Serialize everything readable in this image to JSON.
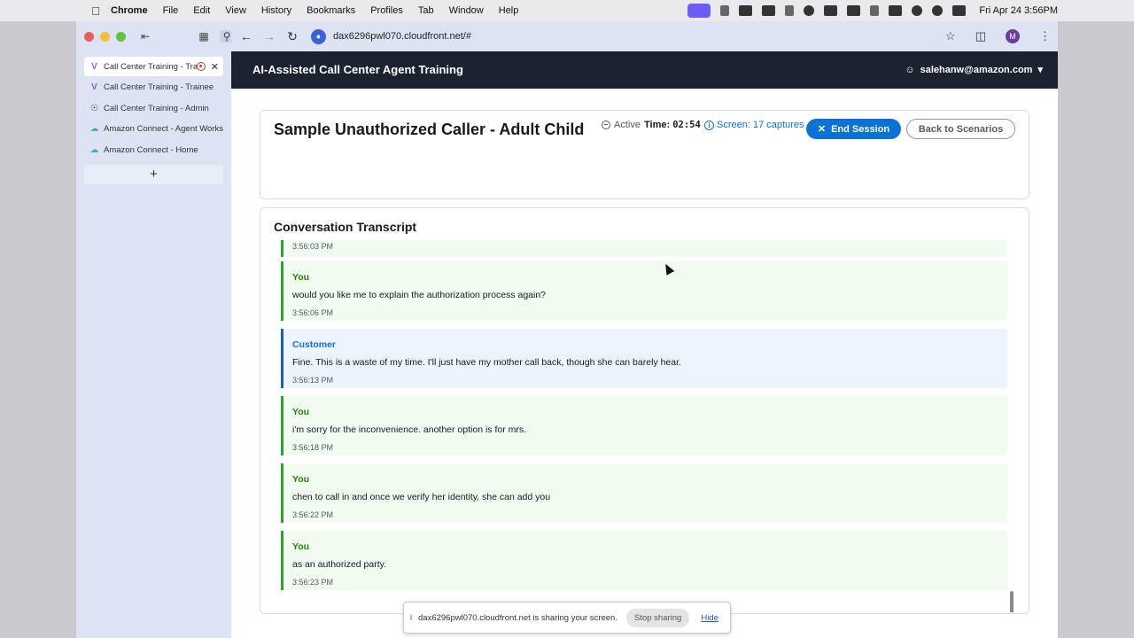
{
  "menubar": {
    "app": "Chrome",
    "items": [
      "File",
      "Edit",
      "View",
      "History",
      "Bookmarks",
      "Profiles",
      "Tab",
      "Window",
      "Help"
    ],
    "clock": "Fri Apr 24  3:56PM"
  },
  "tabs": [
    {
      "label": "Call Center Training - Trainee",
      "favicon": "v-logo-icon"
    },
    {
      "label": "Call Center Training - Trainee",
      "favicon": "v-logo-icon"
    },
    {
      "label": "Call Center Training - Admin",
      "favicon": "globe-icon"
    },
    {
      "label": "Amazon Connect - Agent Workspace",
      "favicon": "cloud-icon"
    },
    {
      "label": "Amazon Connect - Home",
      "favicon": "cloud-icon"
    }
  ],
  "newtab": "+",
  "url": "dax6296pwl070.cloudfront.net/#",
  "profile_initial": "M",
  "appbar": {
    "title": "AI-Assisted Call Center Agent Training",
    "user": "salehanw@amazon.com"
  },
  "session": {
    "title": "Sample Unauthorized Caller - Adult Child",
    "status": "Active",
    "time_label": "Time:",
    "time_value": "02:54",
    "screen": "Screen: 17 captures",
    "end_label": "End Session",
    "back_label": "Back to Scenarios"
  },
  "transcript": {
    "heading": "Conversation Transcript",
    "partial_time": "3:56:03 PM",
    "messages": [
      {
        "speaker": "You",
        "text": "would you like me to explain the authorization process again?",
        "time": "3:56:06 PM"
      },
      {
        "speaker": "Customer",
        "text": "Fine. This is a waste of my time. I'll just have my mother call back, though she can barely hear.",
        "time": "3:56:13 PM"
      },
      {
        "speaker": "You",
        "text": "i'm sorry for the inconvenience. another option is for mrs.",
        "time": "3:56:18 PM"
      },
      {
        "speaker": "You",
        "text": "chen to call in and once we verify her identity, she can add you",
        "time": "3:56:22 PM"
      },
      {
        "speaker": "You",
        "text": "as an authorized party.",
        "time": "3:56:23 PM"
      }
    ]
  },
  "share_bar": {
    "message": "dax6296pwl070.cloudfront.net is sharing your screen.",
    "stop_label": "Stop sharing",
    "hide_label": "Hide"
  },
  "colors": {
    "appbar_bg": "#1b2330",
    "primary": "#0972d3",
    "agent_border": "#29a329",
    "customer_border": "#1a5fb4"
  }
}
